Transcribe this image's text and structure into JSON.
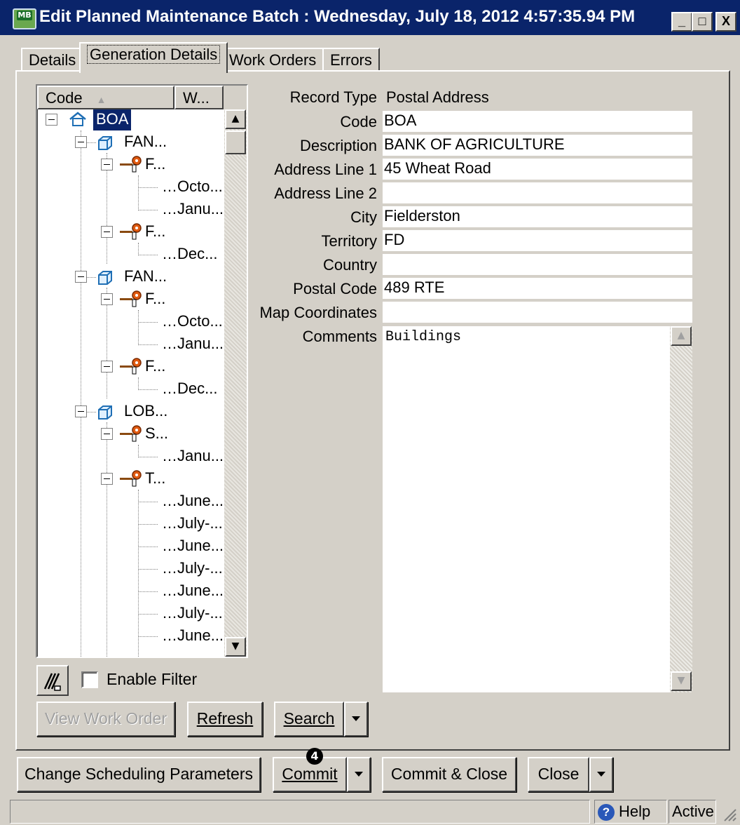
{
  "window": {
    "icon_label": "MB",
    "title": "Edit Planned Maintenance Batch : Wednesday, July 18, 2012 4:57:35.94 PM",
    "min_glyph": "_",
    "max_glyph": "□",
    "close_glyph": "X"
  },
  "tabs": [
    {
      "label": "Details"
    },
    {
      "label": "Generation Details"
    },
    {
      "label": "Work Orders"
    },
    {
      "label": "Errors"
    }
  ],
  "tree": {
    "columns": [
      "Code",
      "W..."
    ],
    "nodes": [
      {
        "label": "BOA"
      },
      {
        "label": "FAN..."
      },
      {
        "label": "F..."
      },
      {
        "label": "Octo..."
      },
      {
        "label": "Janu..."
      },
      {
        "label": "F..."
      },
      {
        "label": "Dec..."
      },
      {
        "label": "FAN..."
      },
      {
        "label": "F..."
      },
      {
        "label": "Octo..."
      },
      {
        "label": "Janu..."
      },
      {
        "label": "F..."
      },
      {
        "label": "Dec..."
      },
      {
        "label": "LOB..."
      },
      {
        "label": "S..."
      },
      {
        "label": "Janu..."
      },
      {
        "label": "T..."
      },
      {
        "label": "June..."
      },
      {
        "label": "July-..."
      },
      {
        "label": "June..."
      },
      {
        "label": "July-..."
      },
      {
        "label": "June..."
      },
      {
        "label": "July-..."
      },
      {
        "label": "June..."
      }
    ]
  },
  "filter": {
    "enable_filter_label": "Enable Filter",
    "checked": false
  },
  "buttons": {
    "view_work_order": "View Work Order",
    "refresh": "Refresh",
    "search": "Search",
    "change_scheduling": "Change Scheduling Parameters",
    "commit": "Commit",
    "commit_close": "Commit & Close",
    "close": "Close"
  },
  "form": {
    "record_type_label": "Record Type",
    "record_type_value": "Postal Address",
    "code_label": "Code",
    "code_value": "BOA",
    "description_label": "Description",
    "description_value": "BANK OF AGRICULTURE",
    "address1_label": "Address Line 1",
    "address1_value": "45 Wheat Road",
    "address2_label": "Address Line 2",
    "address2_value": "",
    "city_label": "City",
    "city_value": "Fielderston",
    "territory_label": "Territory",
    "territory_value": "FD",
    "country_label": "Country",
    "country_value": "",
    "postal_label": "Postal Code",
    "postal_value": "489 RTE",
    "map_label": "Map Coordinates",
    "map_value": "",
    "comments_label": "Comments",
    "comments_value": "Buildings"
  },
  "badge": "4",
  "status": {
    "help": "Help",
    "state": "Active"
  }
}
